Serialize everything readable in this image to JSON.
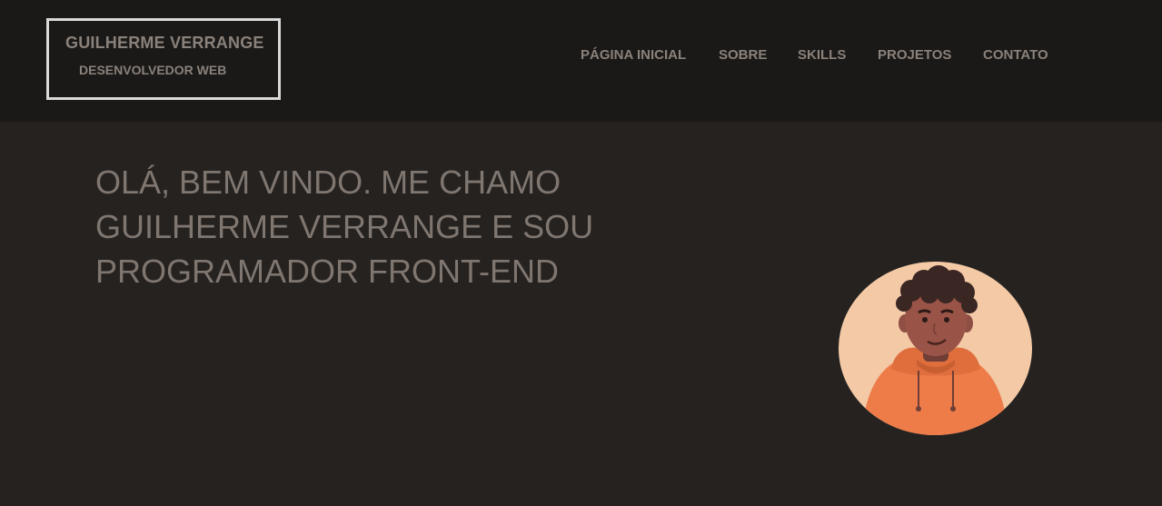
{
  "header": {
    "logo": {
      "name": "GUILHERME VERRANGE",
      "role": "DESENVOLVEDOR WEB"
    },
    "nav": [
      {
        "label": "PÁGINA INICIAL"
      },
      {
        "label": "SOBRE"
      },
      {
        "label": "SKILLS"
      },
      {
        "label": "PROJETOS"
      },
      {
        "label": "CONTATO"
      }
    ]
  },
  "hero": {
    "title_lines": [
      "OLÁ, BEM VINDO. ME CHAMO",
      "GUILHERME VERRANGE E SOU",
      "PROGRAMADOR FRONT-END"
    ],
    "avatar_icon": "person-avatar-illustration"
  },
  "colors": {
    "header_bg": "#1a1918",
    "page_bg": "#252220",
    "text": "#8a817a",
    "logo_border": "#d9d9d9",
    "avatar_bg": "#f3c9a6",
    "hoodie": "#ee7c49"
  }
}
